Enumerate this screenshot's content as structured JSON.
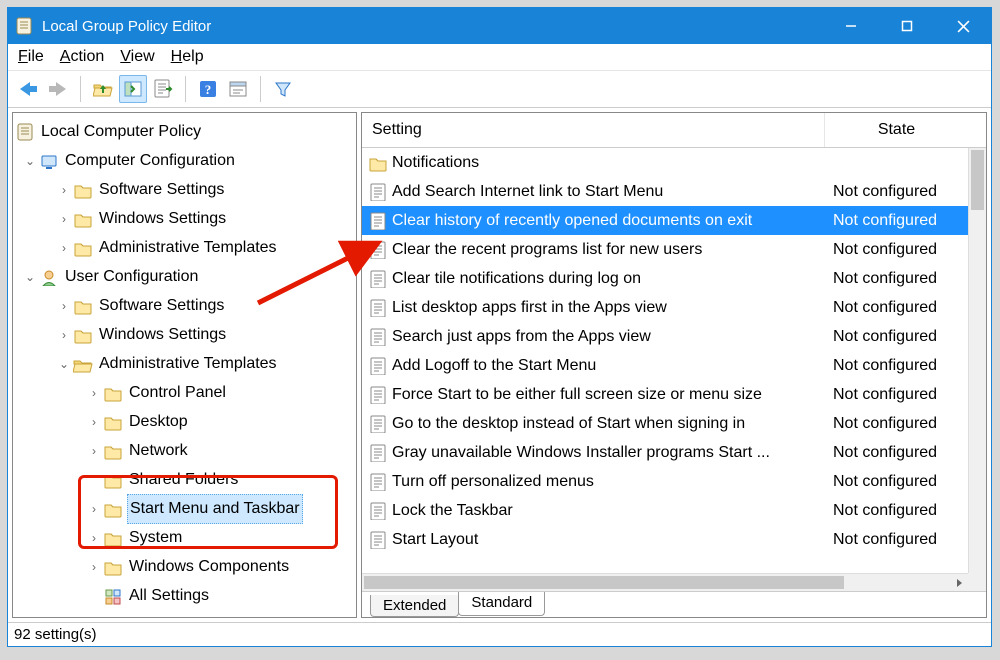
{
  "window": {
    "title": "Local Group Policy Editor"
  },
  "menu": {
    "file": "File",
    "action": "Action",
    "view": "View",
    "help": "Help"
  },
  "tree": {
    "root": "Local Computer Policy",
    "computer_cfg": "Computer Configuration",
    "cc_software": "Software Settings",
    "cc_windows": "Windows Settings",
    "cc_admin": "Administrative Templates",
    "user_cfg": "User Configuration",
    "uc_software": "Software Settings",
    "uc_windows": "Windows Settings",
    "uc_admin": "Administrative Templates",
    "control_panel": "Control Panel",
    "desktop": "Desktop",
    "network": "Network",
    "shared_folders": "Shared Folders",
    "start_menu": "Start Menu and Taskbar",
    "system": "System",
    "win_components": "Windows Components",
    "all_settings": "All Settings"
  },
  "list": {
    "col_setting": "Setting",
    "col_state": "State",
    "items": [
      {
        "type": "folder",
        "name": "Notifications",
        "state": ""
      },
      {
        "type": "policy",
        "name": "Add Search Internet link to Start Menu",
        "state": "Not configured"
      },
      {
        "type": "policy",
        "name": "Clear history of recently opened documents on exit",
        "state": "Not configured",
        "selected": true
      },
      {
        "type": "policy",
        "name": "Clear the recent programs list for new users",
        "state": "Not configured"
      },
      {
        "type": "policy",
        "name": "Clear tile notifications during log on",
        "state": "Not configured"
      },
      {
        "type": "policy",
        "name": "List desktop apps first in the Apps view",
        "state": "Not configured"
      },
      {
        "type": "policy",
        "name": "Search just apps from the Apps view",
        "state": "Not configured"
      },
      {
        "type": "policy",
        "name": "Add Logoff to the Start Menu",
        "state": "Not configured"
      },
      {
        "type": "policy",
        "name": "Force Start to be either full screen size or menu size",
        "state": "Not configured"
      },
      {
        "type": "policy",
        "name": "Go to the desktop instead of Start when signing in",
        "state": "Not configured"
      },
      {
        "type": "policy",
        "name": "Gray unavailable Windows Installer programs Start ...",
        "state": "Not configured"
      },
      {
        "type": "policy",
        "name": "Turn off personalized menus",
        "state": "Not configured"
      },
      {
        "type": "policy",
        "name": "Lock the Taskbar",
        "state": "Not configured"
      },
      {
        "type": "policy",
        "name": "Start Layout",
        "state": "Not configured"
      }
    ]
  },
  "tabs": {
    "extended": "Extended",
    "standard": "Standard"
  },
  "status": "92 setting(s)"
}
